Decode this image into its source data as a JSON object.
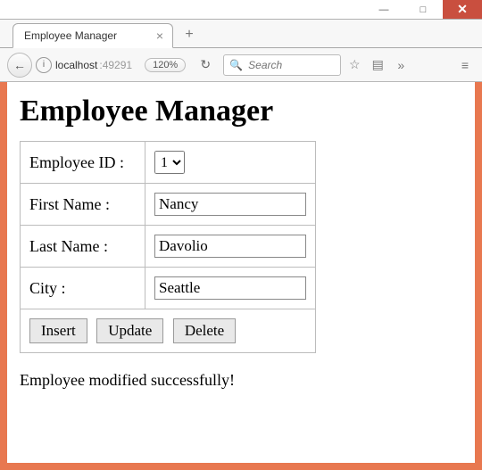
{
  "window": {
    "minimize": "—",
    "maximize": "□",
    "close": "✕"
  },
  "tab": {
    "title": "Employee Manager",
    "close": "×",
    "newtab": "+"
  },
  "nav": {
    "back": "←",
    "info": "i",
    "host": "localhost",
    "port": ":49291",
    "zoom": "120%",
    "reload": "↻",
    "search_placeholder": "Search",
    "star": "☆",
    "clipboard": "▤",
    "more": "»",
    "menu": "≡"
  },
  "page": {
    "heading": "Employee Manager",
    "labels": {
      "employee_id": "Employee ID :",
      "first_name": "First Name :",
      "last_name": "Last Name :",
      "city": "City :"
    },
    "values": {
      "employee_id": "1",
      "first_name": "Nancy",
      "last_name": "Davolio",
      "city": "Seattle"
    },
    "buttons": {
      "insert": "Insert",
      "update": "Update",
      "delete": "Delete"
    },
    "status": "Employee modified successfully!"
  }
}
